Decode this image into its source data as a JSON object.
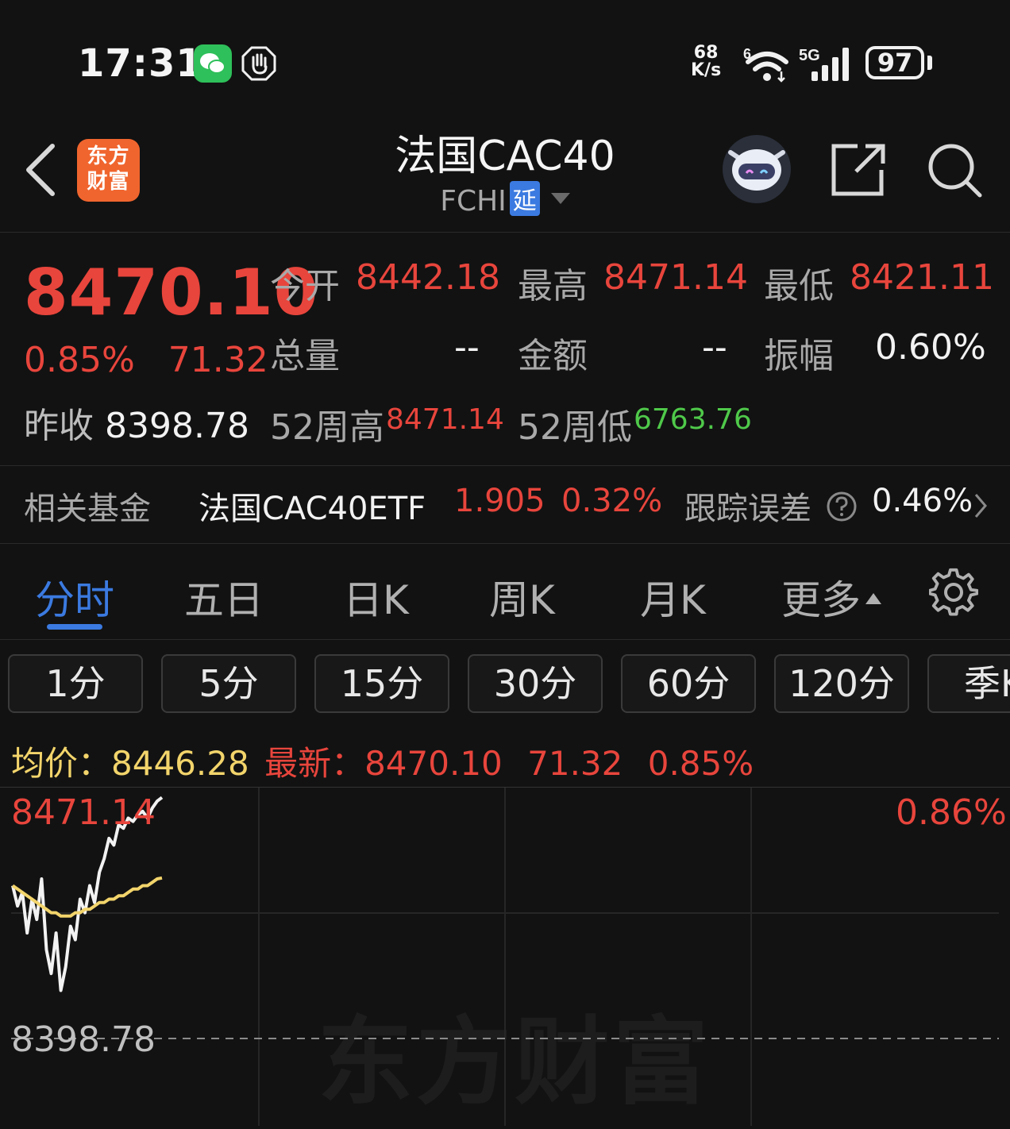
{
  "status_bar": {
    "time": "17:31",
    "net_speed_value": "68",
    "net_speed_unit": "K/s",
    "wifi_sup": "6",
    "signal_label": "5G",
    "battery": "97"
  },
  "header": {
    "app_logo_line1": "东方",
    "app_logo_line2": "财富",
    "title": "法国CAC40",
    "code": "FCHI",
    "delay_badge": "延"
  },
  "quote": {
    "price": "8470.10",
    "change_pct": "0.85%",
    "change": "71.32",
    "prev_close_label": "昨收",
    "prev_close": "8398.78",
    "open_label": "今开",
    "open": "8442.18",
    "high_label": "最高",
    "high": "8471.14",
    "low_label": "最低",
    "low": "8421.11",
    "volume_label": "总量",
    "volume": "--",
    "amount_label": "金额",
    "amount": "--",
    "amplitude_label": "振幅",
    "amplitude": "0.60%",
    "wk52_high_label": "52周高",
    "wk52_high": "8471.14",
    "wk52_low_label": "52周低",
    "wk52_low": "6763.76"
  },
  "fund": {
    "label": "相关基金",
    "name": "法国CAC40ETF",
    "price": "1.905",
    "pct": "0.32%",
    "tracking_label": "跟踪误差",
    "tracking_value": "0.46%"
  },
  "tabs": [
    "分时",
    "五日",
    "日K",
    "周K",
    "月K",
    "更多"
  ],
  "periods": [
    "1分",
    "5分",
    "15分",
    "30分",
    "60分",
    "120分",
    "季K"
  ],
  "chart_header": {
    "avg_label": "均价：",
    "avg_value": "8446.28",
    "latest_label": "最新：",
    "latest_value": "8470.10",
    "latest_change": "71.32",
    "latest_pct": "0.85%"
  },
  "chart": {
    "top_label": "8471.14",
    "top_pct": "0.86%",
    "base_label": "8398.78",
    "watermark": "东方财富"
  },
  "colors": {
    "up": "#e8453c",
    "down": "#4fc94a",
    "accent": "#3b7ae0",
    "avg_line": "#f2d46b",
    "price_line": "#f2f2f2"
  },
  "chart_data": {
    "type": "line",
    "ylim": [
      8398.78,
      8471.14
    ],
    "series": [
      {
        "name": "最新",
        "values": [
          8444,
          8438,
          8442,
          8430,
          8440,
          8434,
          8446,
          8425,
          8418,
          8430,
          8413,
          8420,
          8432,
          8428,
          8440,
          8436,
          8444,
          8439,
          8448,
          8452,
          8458,
          8456,
          8462,
          8461,
          8464,
          8463,
          8465,
          8466,
          8464,
          8467,
          8469,
          8470.1
        ]
      },
      {
        "name": "均价",
        "values": [
          8444,
          8443,
          8442,
          8441,
          8440,
          8439,
          8438,
          8437,
          8436,
          8436,
          8435,
          8435,
          8435,
          8436,
          8436,
          8437,
          8437,
          8438,
          8439,
          8439,
          8440,
          8440,
          8441,
          8441,
          8442,
          8443,
          8443,
          8444,
          8444,
          8445,
          8446,
          8446.28
        ]
      }
    ]
  }
}
